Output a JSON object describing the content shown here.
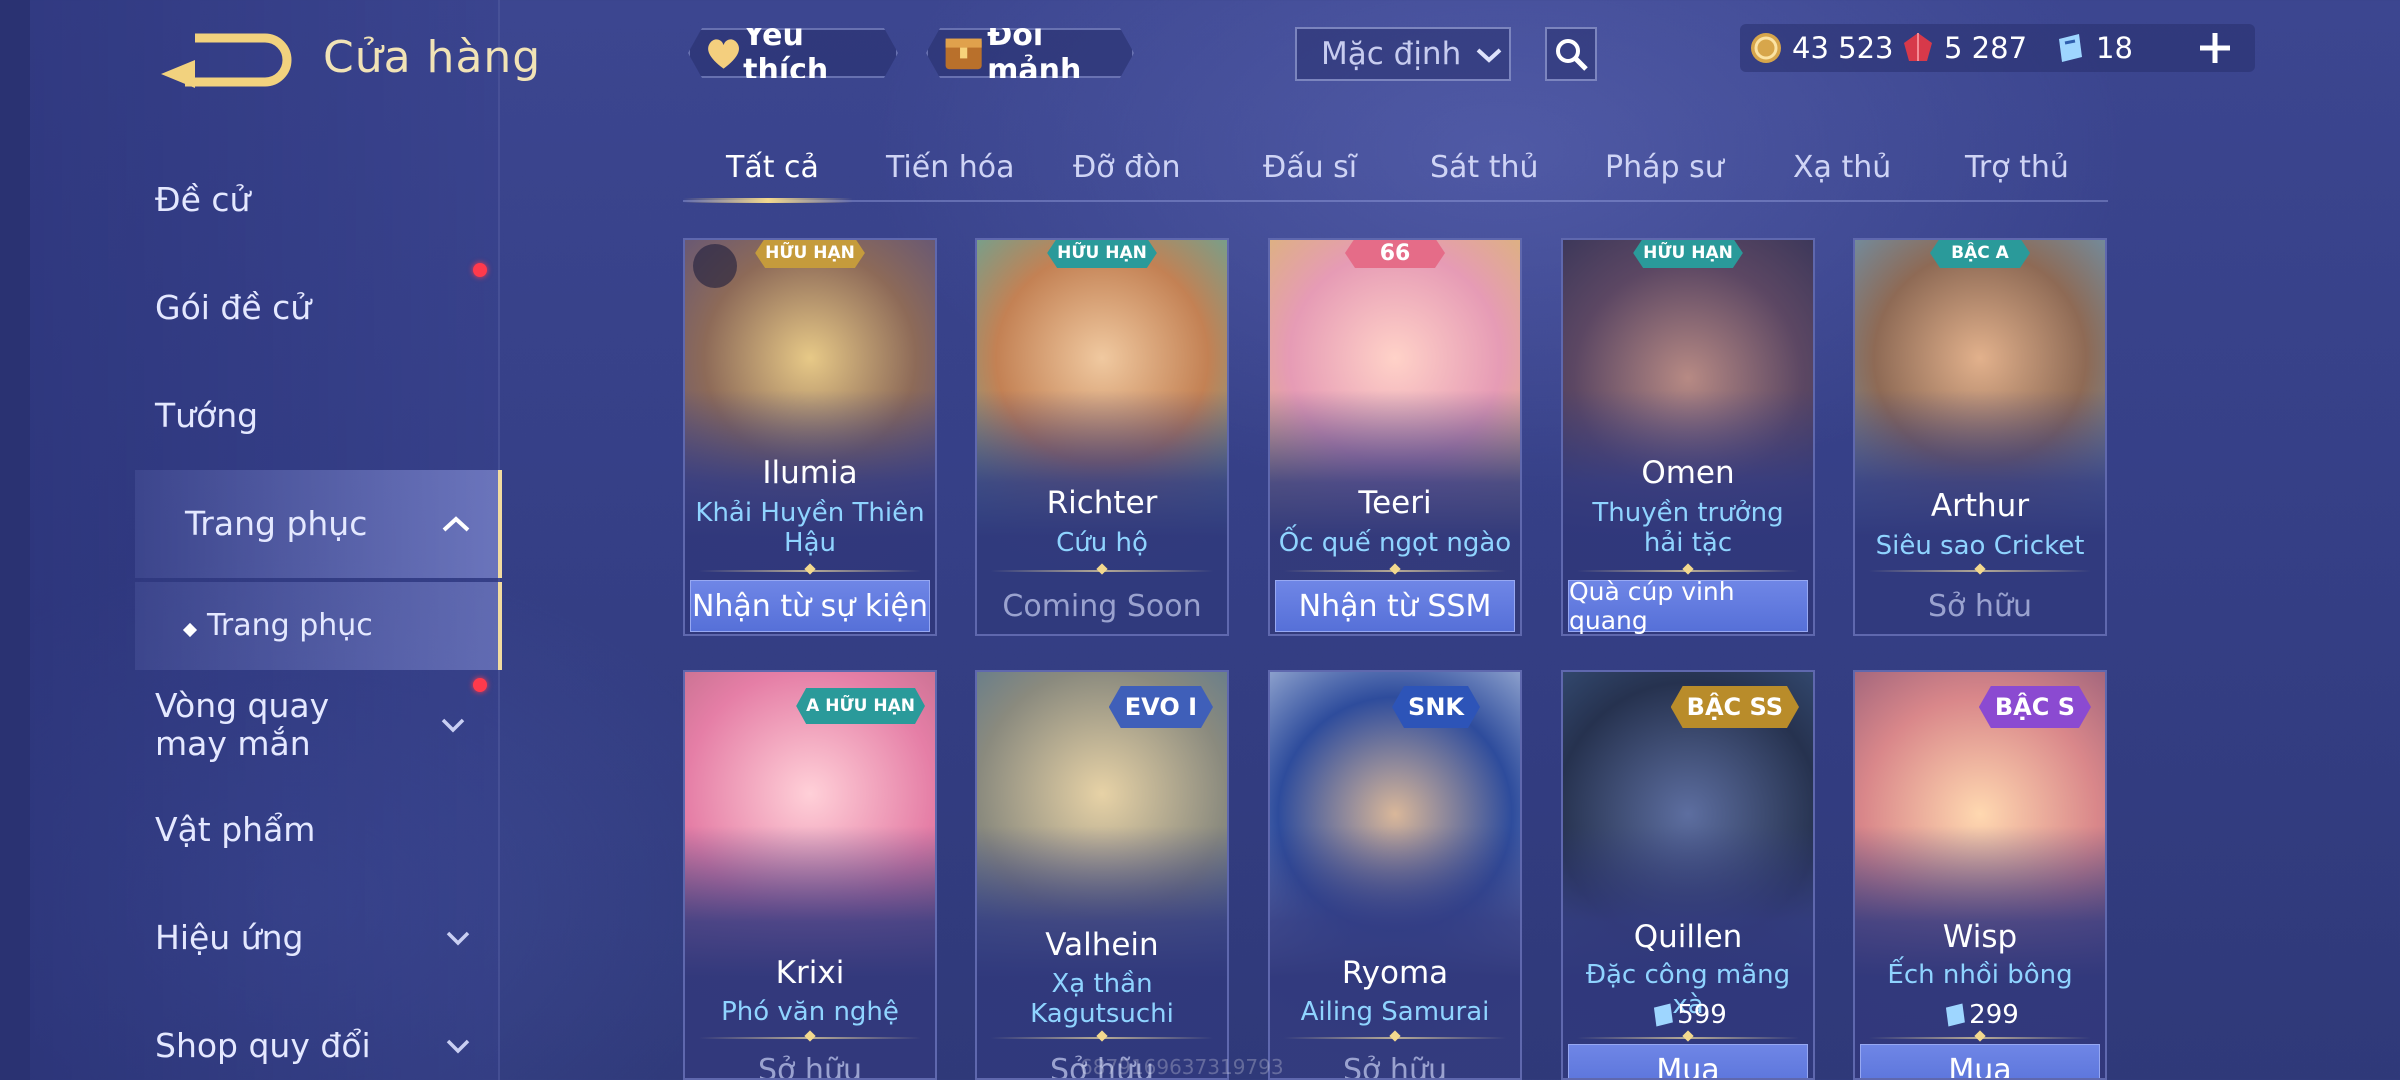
{
  "header": {
    "title": "Cửa hàng",
    "favorite_label": "Yêu thích",
    "exchange_label": "Đổi mảnh",
    "sort_value": "Mặc định"
  },
  "currencies": [
    {
      "name": "gold-coin",
      "value": "43 523"
    },
    {
      "name": "ruby-gem",
      "value": "5 287"
    },
    {
      "name": "quan-huy-voucher",
      "value": "18"
    }
  ],
  "sidebar": {
    "items": [
      {
        "label": "Đề cử"
      },
      {
        "label": "Gói đề cử"
      },
      {
        "label": "Tướng"
      },
      {
        "label": "Trang phục"
      },
      {
        "label": "Trang phục"
      },
      {
        "label": "Vòng quay may mắn"
      },
      {
        "label": "Vật phẩm"
      },
      {
        "label": "Hiệu ứng"
      },
      {
        "label": "Shop quy đổi"
      }
    ]
  },
  "tabs": [
    "Tất cả",
    "Tiến hóa",
    "Đỡ đòn",
    "Đấu sĩ",
    "Sát thủ",
    "Pháp sư",
    "Xạ thủ",
    "Trợ thủ"
  ],
  "cards": [
    {
      "hero": "Ilumia",
      "skin": "Khải Huyền Thiên Hậu",
      "badge": "HỮU HẠN",
      "action": "Nhận từ sự kiện",
      "action_type": "btn"
    },
    {
      "hero": "Richter",
      "skin": "Cứu hộ",
      "badge": "HỮU HẠN",
      "action": "Coming Soon",
      "action_type": "txt"
    },
    {
      "hero": "Teeri",
      "skin": "Ốc quế ngọt ngào",
      "badge": "66",
      "action": "Nhận từ SSM",
      "action_type": "btn"
    },
    {
      "hero": "Omen",
      "skin": "Thuyền trưởng hải tặc",
      "badge": "HỮU HẠN",
      "action": "Quà cúp vinh quang",
      "action_type": "btn"
    },
    {
      "hero": "Arthur",
      "skin": "Siêu sao Cricket",
      "badge": "BẬC A",
      "action": "Sở hữu",
      "action_type": "txt"
    },
    {
      "hero": "Krixi",
      "skin": "Phó văn nghệ",
      "badge": "A HỮU HẠN",
      "action": "Sở hữu",
      "action_type": "txt"
    },
    {
      "hero": "Valhein",
      "skin": "Xạ thần Kagutsuchi",
      "badge": "EVO I",
      "action": "Sở hữu",
      "action_type": "txt"
    },
    {
      "hero": "Ryoma",
      "skin": "Ailing Samurai",
      "badge": "SNK",
      "action": "Sở hữu",
      "action_type": "txt"
    },
    {
      "hero": "Quillen",
      "skin": "Đặc công mãng xà",
      "badge": "BẬC SS",
      "price": "599",
      "action": "Mua",
      "action_type": "btn"
    },
    {
      "hero": "Wisp",
      "skin": "Ếch nhồi bông",
      "badge": "BẬC S",
      "price": "299",
      "action": "Mua",
      "action_type": "btn"
    }
  ],
  "watermark": "6879169637319793",
  "colors": {
    "accent_gold": "#f3d98e",
    "skin_name": "#8fd4ff",
    "button_blue": "#5e78de",
    "notification_red": "#ff3a4c"
  }
}
